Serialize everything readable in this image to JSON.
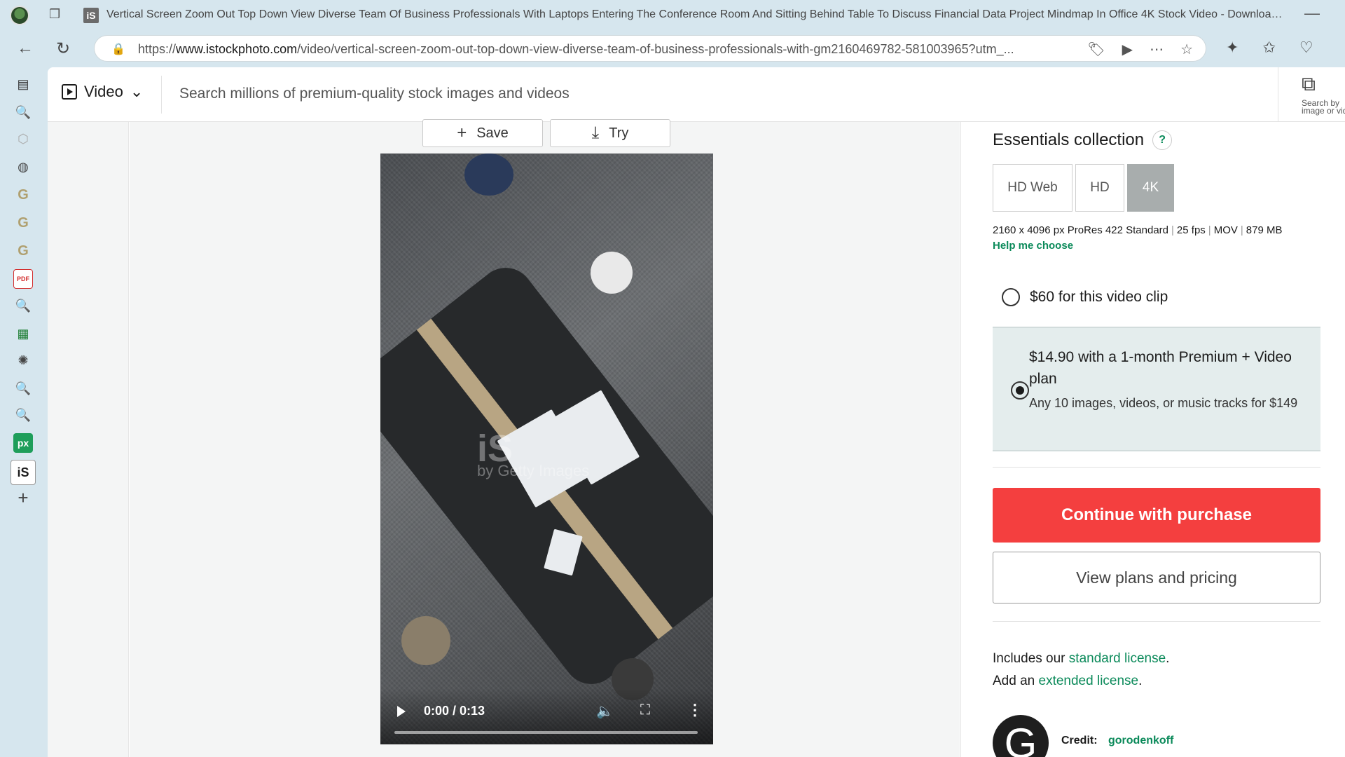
{
  "browser": {
    "tab_title": "Vertical Screen Zoom Out Top Down View Diverse Team Of Business Professionals With Laptops Entering The Conference Room And Sitting Behind Table To Discuss Financial Data Project Mindmap In Office 4K Stock Video - Download Vide...",
    "favicon_text": "iS",
    "url_prefix": "https://",
    "url_host": "www.istockphoto.com",
    "url_path": "/video/vertical-screen-zoom-out-top-down-view-diverse-team-of-business-professionals-with-gm2160469782-581003965?utm_..."
  },
  "sidebar": {
    "items": [
      {
        "icon": "tabs-panel-icon",
        "glyph": "▤",
        "color": "#333"
      },
      {
        "icon": "search-icon",
        "glyph": "🔍",
        "color": "#3a7bd5"
      },
      {
        "icon": "shield-icon",
        "glyph": "⬡",
        "color": "#aaa"
      },
      {
        "icon": "globe-icon",
        "glyph": "◍",
        "color": "#444"
      },
      {
        "icon": "g-app-icon",
        "glyph": "G",
        "color": "#b0a070"
      },
      {
        "icon": "g-app-icon",
        "glyph": "G",
        "color": "#b0a070"
      },
      {
        "icon": "g-app-icon",
        "glyph": "G",
        "color": "#b0a070"
      },
      {
        "icon": "pdf-icon",
        "glyph": "PDF",
        "color": "#d32f2f"
      },
      {
        "icon": "search-icon",
        "glyph": "🔍",
        "color": "#3a7bd5"
      },
      {
        "icon": "calc-icon",
        "glyph": "▦",
        "color": "#1e7e34"
      },
      {
        "icon": "openai-icon",
        "glyph": "✺",
        "color": "#444"
      },
      {
        "icon": "search-icon",
        "glyph": "🔍",
        "color": "#3a7bd5"
      },
      {
        "icon": "search-icon",
        "glyph": "🔍",
        "color": "#3a7bd5"
      },
      {
        "icon": "px-icon",
        "glyph": "px",
        "color": "#1e9e5a"
      },
      {
        "icon": "istock-icon",
        "glyph": "iS",
        "color": "#1b1b1b"
      },
      {
        "icon": "add-icon",
        "glyph": "+",
        "color": "#444"
      }
    ]
  },
  "header": {
    "media_type": "Video",
    "search_placeholder": "Search millions of premium-quality stock images and videos",
    "image_search_label": "Search by image or video"
  },
  "actions": {
    "save_label": "Save",
    "try_label": "Try"
  },
  "video": {
    "watermark_logo": "iS",
    "watermark_by": "by Getty Images",
    "time": "0:00 / 0:13",
    "progress": 0
  },
  "purchase": {
    "collection_title": "Essentials collection",
    "help_glyph": "?",
    "resolutions": [
      "HD Web",
      "HD",
      "4K"
    ],
    "selected_resolution": "4K",
    "spec_dims": "2160 x 4096 px ProRes 422 Standard",
    "spec_fps": "25 fps",
    "spec_format": "MOV",
    "spec_size": "879 MB",
    "help_choose": "Help me choose",
    "option1": "$60 for this video clip",
    "option2_title": "$14.90 with a 1-month Premium + Video plan",
    "option2_sub": "Any 10 images, videos, or music tracks for $149",
    "buy_label": "Continue with purchase",
    "plans_label": "View plans and pricing",
    "includes_text": "Includes our",
    "standard_license": "standard license",
    "add_text": "Add an",
    "extended_license": "extended license",
    "credit_label": "Credit:",
    "credit_name": "gorodenkoff",
    "avatar_letter": "G"
  },
  "colors": {
    "accent_green": "#0b8a5a",
    "buy_red": "#f43f3f",
    "selected_res_bg": "#a8adad"
  }
}
